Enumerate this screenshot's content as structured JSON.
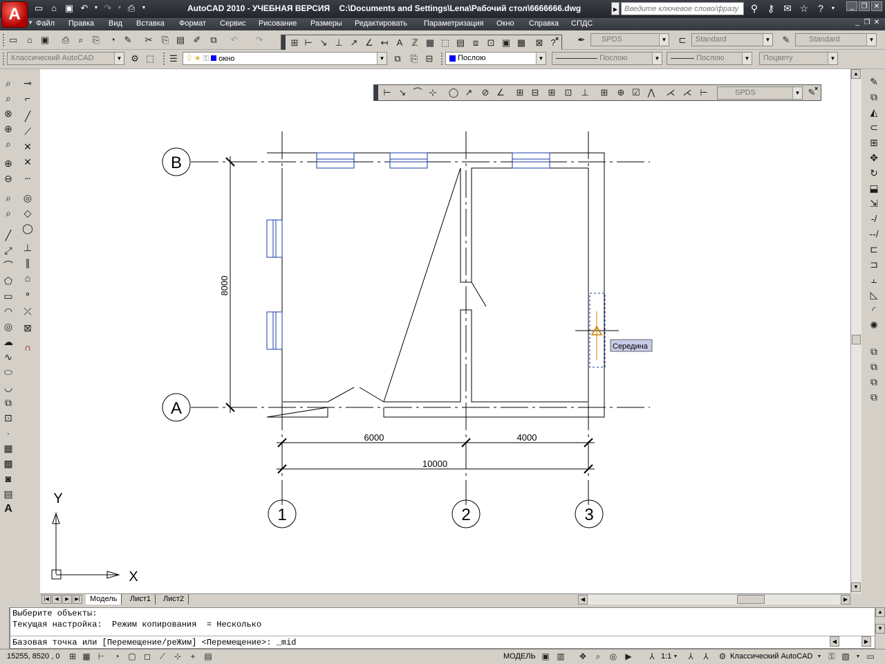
{
  "window": {
    "title": "AutoCAD 2010 - УЧЕБНАЯ ВЕРСИЯ    C:\\Documents and Settings\\Lena\\Рабочий стол\\6666666.dwg",
    "logo": "A",
    "search_placeholder": "Введите ключевое слово/фразу"
  },
  "menu": [
    "Файл",
    "Правка",
    "Вид",
    "Вставка",
    "Формат",
    "Сервис",
    "Рисование",
    "Размеры",
    "Редактировать",
    "Параметризация",
    "Окно",
    "Справка",
    "СПДС"
  ],
  "toolbar2": {
    "text_style": "SPDS",
    "dim_style": "Standard",
    "table_style": "Standard"
  },
  "toolbar3": {
    "workspace": "Классический AutoCAD",
    "layer": "окно",
    "color": "Послою",
    "linetype": "Послою",
    "lineweight": "Послою",
    "plotstyle": "Поцвету"
  },
  "dim_toolbar": {
    "style": "SPDS"
  },
  "drawing": {
    "axis_letters": [
      "В",
      "А"
    ],
    "axis_numbers": [
      "1",
      "2",
      "3"
    ],
    "dim_vertical": "8000",
    "dim_6000": "6000",
    "dim_4000": "4000",
    "dim_10000": "10000",
    "snap_tooltip": "Середина",
    "ucs_x": "X",
    "ucs_y": "Y"
  },
  "layout_tabs": [
    "Модель",
    "Лист1",
    "Лист2"
  ],
  "command": {
    "line1": "Выберите объекты:",
    "line2": "Текущая настройка:  Режим копирования  = Несколько",
    "line3": "Базовая точка или [Перемещение/реЖим] <Перемещение>: _mid"
  },
  "status": {
    "coords": "15255, 8520 , 0",
    "model_label": "МОДЕЛЬ",
    "scale": "1:1",
    "workspace": "Классический AutoCAD"
  },
  "colors": {
    "window_blue": "#1a3aa8",
    "snap_marker": "#d08000",
    "tooltip_bg": "#c8cae8"
  }
}
